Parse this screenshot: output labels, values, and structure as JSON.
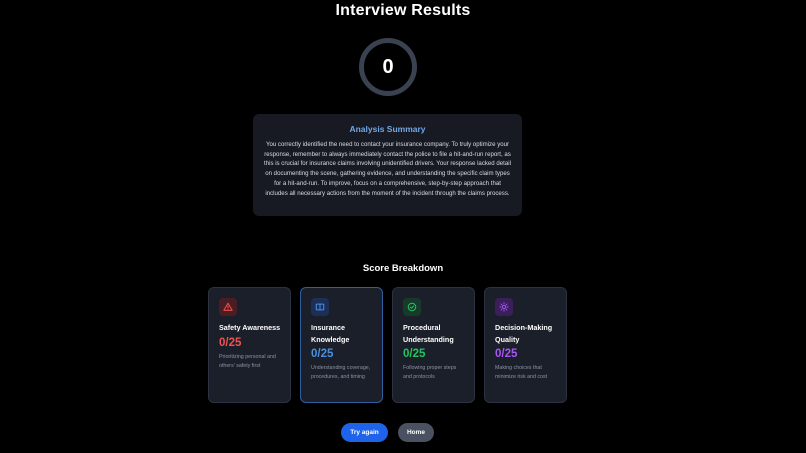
{
  "header": {
    "title": "Interview Results"
  },
  "score": {
    "total": "0"
  },
  "summary": {
    "heading": "Analysis Summary",
    "text": "You correctly identified the need to contact your insurance company. To truly optimize your response, remember to always immediately contact the police to file a hit-and-run report, as this is crucial for insurance claims involving unidentified drivers. Your response lacked detail on documenting the scene, gathering evidence, and understanding the specific claim types for a hit-and-run. To improve, focus on a comprehensive, step-by-step approach that includes all necessary actions from the moment of the incident through the claims process."
  },
  "breakdown": {
    "title": "Score Breakdown",
    "cards": [
      {
        "name": "Safety Awareness",
        "score": "0/25",
        "description": "Prioritizing personal and others' safety first",
        "icon": "warning-triangle-icon",
        "color": "#ef5350",
        "icon_bg": "#4a1d24"
      },
      {
        "name": "Insurance Knowledge",
        "score": "0/25",
        "description": "Understanding coverage, procedures, and timing",
        "icon": "book-icon",
        "color": "#4a90e2",
        "icon_bg": "#1c2f57"
      },
      {
        "name": "Procedural Understanding",
        "score": "0/25",
        "description": "Following proper steps and protocols",
        "icon": "check-circle-icon",
        "color": "#22c55e",
        "icon_bg": "#173a2a"
      },
      {
        "name": "Decision-Making Quality",
        "score": "0/25",
        "description": "Making choices that minimize risk and cost",
        "icon": "lightbulb-icon",
        "color": "#a855f7",
        "icon_bg": "#3a1f5a"
      }
    ]
  },
  "actions": {
    "try_again": "Try again",
    "home": "Home"
  }
}
